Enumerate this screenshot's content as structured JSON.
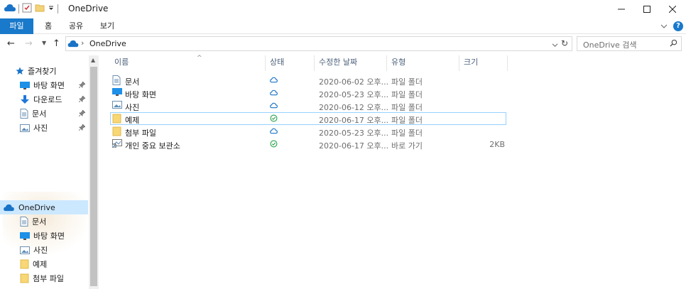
{
  "window": {
    "title": "OneDrive"
  },
  "ribbon": {
    "tabs": [
      "파일",
      "홈",
      "공유",
      "보기"
    ]
  },
  "address": {
    "path": "OneDrive",
    "search_placeholder": "OneDrive 검색"
  },
  "nav": {
    "quick_access": "즐겨찾기",
    "quick_items": [
      "바탕 화면",
      "다운로드",
      "문서",
      "사진"
    ],
    "onedrive": "OneDrive",
    "onedrive_items": [
      "문서",
      "바탕 화면",
      "사진",
      "예제",
      "첨부 파일"
    ]
  },
  "columns": [
    "이름",
    "상태",
    "수정한 날짜",
    "유형",
    "크기"
  ],
  "files": [
    {
      "name": "문서",
      "icon": "document-folder-icon",
      "status": "cloud",
      "date": "2020-06-02 오후...",
      "type": "파일 폴더",
      "size": ""
    },
    {
      "name": "바탕 화면",
      "icon": "desktop-folder-icon",
      "status": "cloud",
      "date": "2020-05-23 오후...",
      "type": "파일 폴더",
      "size": ""
    },
    {
      "name": "사진",
      "icon": "pictures-folder-icon",
      "status": "cloud",
      "date": "2020-06-12 오후...",
      "type": "파일 폴더",
      "size": ""
    },
    {
      "name": "예제",
      "icon": "folder-icon",
      "status": "synced",
      "date": "2020-06-17 오후...",
      "type": "파일 폴더",
      "size": ""
    },
    {
      "name": "첨부 파일",
      "icon": "folder-icon",
      "status": "cloud",
      "date": "2020-05-23 오후...",
      "type": "파일 폴더",
      "size": ""
    },
    {
      "name": "개인 중요 보관소",
      "icon": "shortcut-icon",
      "status": "synced",
      "date": "2020-06-17 오후...",
      "type": "바로 가기",
      "size": "2KB"
    }
  ],
  "colors": {
    "accent": "#1979ca",
    "cloud": "#1a73c7",
    "synced": "#24a148",
    "selection": "#cce8ff"
  }
}
